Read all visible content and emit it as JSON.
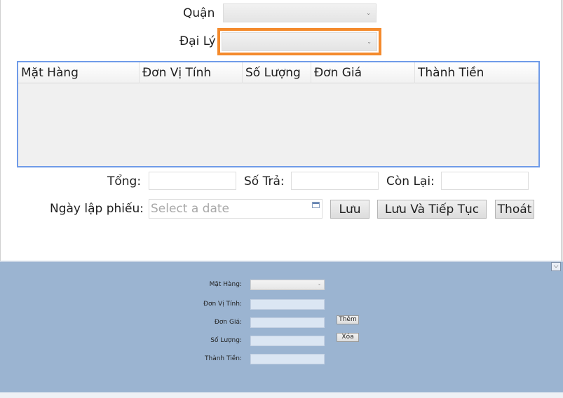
{
  "form": {
    "quan_label": "Quận",
    "quan_value": "",
    "daily_label": "Đại Lý",
    "daily_value": ""
  },
  "grid": {
    "columns": [
      "Mặt Hàng",
      "Đơn Vị Tính",
      "Số Lượng",
      "Đơn Giá",
      "Thành Tiền"
    ],
    "rows": []
  },
  "totals": {
    "tong_label": "Tổng:",
    "tong_value": "",
    "sotra_label": "Số Trả:",
    "sotra_value": "",
    "conlai_label": "Còn Lại:",
    "conlai_value": ""
  },
  "date": {
    "label": "Ngày lập phiếu:",
    "placeholder": "Select a date"
  },
  "actions": {
    "save": "Lưu",
    "save_continue": "Lưu Và Tiếp Tục",
    "exit": "Thoát"
  },
  "panel": {
    "collapse_glyph": "⌵",
    "mathang_label": "Mặt Hàng:",
    "donvitinh_label": "Đơn Vị Tính:",
    "dongia_label": "Đơn Giá:",
    "soluong_label": "Số Lượng:",
    "thanhtien_label": "Thành Tiền:",
    "add_button": "Thêm",
    "delete_button": "Xóa"
  },
  "colors": {
    "focus": "#f48a2c",
    "grid_border": "#6f9be8",
    "panel_bg": "#9bb4d1"
  }
}
